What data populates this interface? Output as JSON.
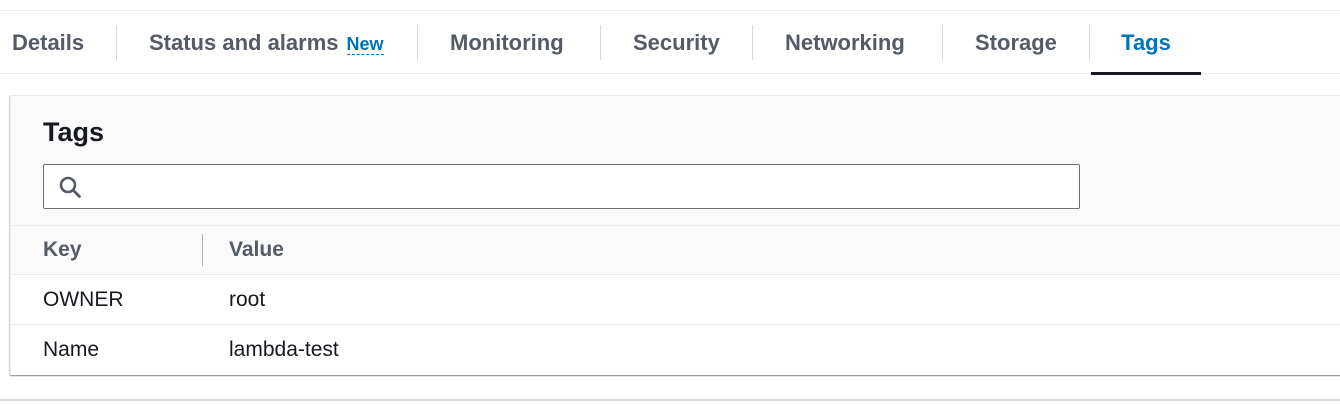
{
  "tabs": [
    {
      "label": "Details",
      "active": false
    },
    {
      "label": "Status and alarms",
      "badge": "New",
      "active": false
    },
    {
      "label": "Monitoring",
      "active": false
    },
    {
      "label": "Security",
      "active": false
    },
    {
      "label": "Networking",
      "active": false
    },
    {
      "label": "Storage",
      "active": false
    },
    {
      "label": "Tags",
      "active": true
    }
  ],
  "panel": {
    "title": "Tags",
    "search": {
      "value": "",
      "placeholder": ""
    }
  },
  "table": {
    "columns": [
      "Key",
      "Value"
    ],
    "rows": [
      {
        "key": "OWNER",
        "value": "root"
      },
      {
        "key": "Name",
        "value": "lambda-test"
      }
    ]
  },
  "colors": {
    "accent": "#0073bb",
    "text": "#16191f",
    "muted": "#545b64"
  },
  "icons": {
    "search": "search-icon"
  }
}
